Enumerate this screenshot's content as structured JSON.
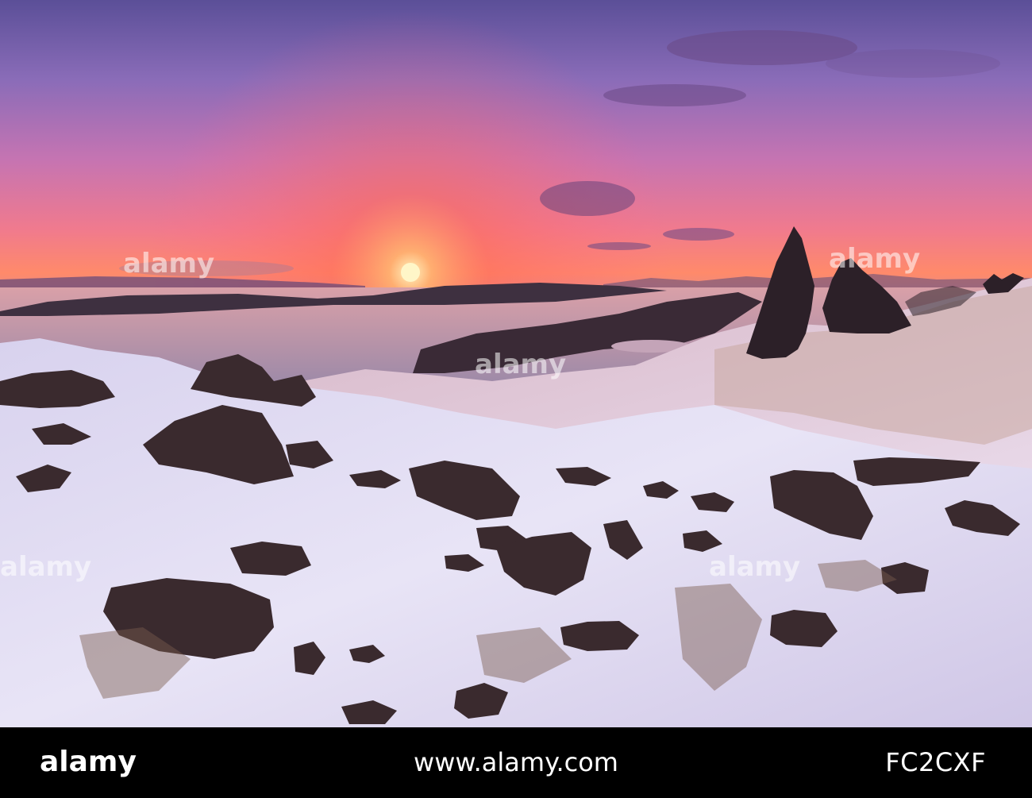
{
  "footer": {
    "brand": "alamy",
    "image_id": "FC2CXF",
    "url": "www.alamy.com"
  },
  "watermark": {
    "text": "alamy",
    "color": "#ffffff"
  },
  "colors": {
    "sky_top": "#6b5fa8",
    "sky_mid": "#c46ea8",
    "sunset_glow": "#ff5a4a",
    "sun": "#fff2b0",
    "sea": "#c89aa8",
    "snow": "#e8e4f2",
    "rock": "#3a2a2e",
    "footer_bg": "#000000"
  }
}
